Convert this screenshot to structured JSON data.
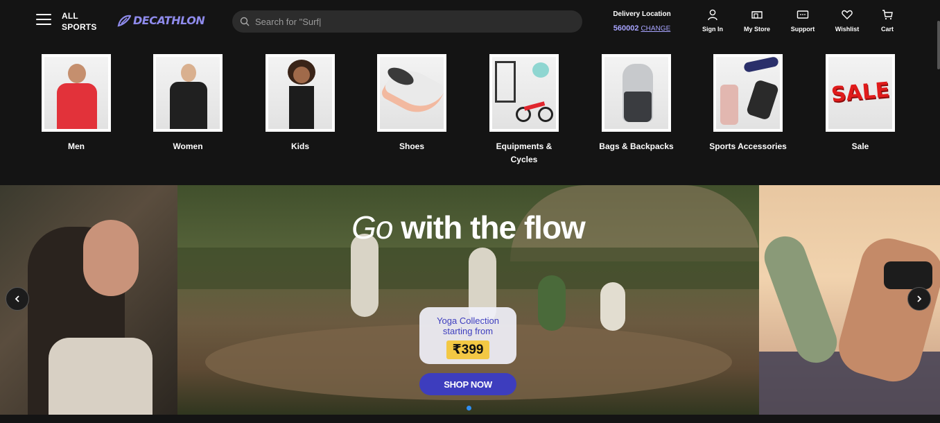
{
  "header": {
    "all_sports": "ALL SPORTS",
    "logo": "DECATHLON",
    "search_placeholder": "Search for \"Surf|",
    "delivery_label": "Delivery Location",
    "pincode": "560002",
    "change": "CHANGE",
    "nav": [
      {
        "label": "Sign In",
        "icon": "user-icon"
      },
      {
        "label": "My Store",
        "icon": "store-icon"
      },
      {
        "label": "Support",
        "icon": "support-icon"
      },
      {
        "label": "Wishlist",
        "icon": "heart-icon"
      },
      {
        "label": "Cart",
        "icon": "cart-icon"
      }
    ]
  },
  "categories": [
    {
      "label": "Men"
    },
    {
      "label": "Women"
    },
    {
      "label": "Kids"
    },
    {
      "label": "Shoes"
    },
    {
      "label": "Equipments & Cycles"
    },
    {
      "label": "Bags & Backpacks"
    },
    {
      "label": "Sports Accessories"
    },
    {
      "label": "Sale"
    }
  ],
  "hero": {
    "title_italic": "Go",
    "title_rest": " with the flow",
    "promo_line1": "Yoga Collection",
    "promo_line2": "starting from",
    "price": "₹399",
    "cta": "SHOP NOW"
  },
  "sale_tile_text": "SALE",
  "colors": {
    "background": "#141414",
    "brand": "#8f8bec",
    "accent": "#3d3dbe",
    "price_tag": "#f3c844",
    "dot_active": "#2f8ef3"
  }
}
